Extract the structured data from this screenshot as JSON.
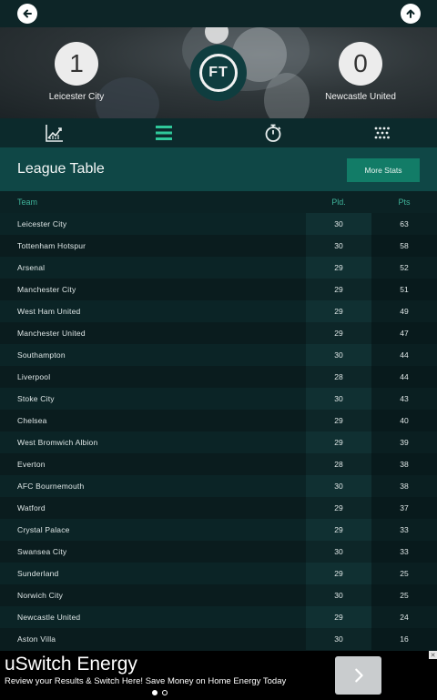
{
  "match": {
    "home": {
      "name": "Leicester City",
      "score": "1"
    },
    "away": {
      "name": "Newcastle United",
      "score": "0"
    },
    "status": "FT"
  },
  "tabs": [
    {
      "icon": "chart-icon",
      "active": false
    },
    {
      "icon": "list-icon",
      "active": true
    },
    {
      "icon": "stopwatch-icon",
      "active": false
    },
    {
      "icon": "grid-dots-icon",
      "active": false
    }
  ],
  "section": {
    "title": "League Table",
    "more_label": "More Stats"
  },
  "table": {
    "headers": {
      "team": "Team",
      "pld": "Pld.",
      "pts": "Pts"
    },
    "rows": [
      {
        "team": "Leicester City",
        "pld": "30",
        "pts": "63"
      },
      {
        "team": "Tottenham Hotspur",
        "pld": "30",
        "pts": "58"
      },
      {
        "team": "Arsenal",
        "pld": "29",
        "pts": "52"
      },
      {
        "team": "Manchester City",
        "pld": "29",
        "pts": "51"
      },
      {
        "team": "West Ham United",
        "pld": "29",
        "pts": "49"
      },
      {
        "team": "Manchester United",
        "pld": "29",
        "pts": "47"
      },
      {
        "team": "Southampton",
        "pld": "30",
        "pts": "44"
      },
      {
        "team": "Liverpool",
        "pld": "28",
        "pts": "44"
      },
      {
        "team": "Stoke City",
        "pld": "30",
        "pts": "43"
      },
      {
        "team": "Chelsea",
        "pld": "29",
        "pts": "40"
      },
      {
        "team": "West Bromwich Albion",
        "pld": "29",
        "pts": "39"
      },
      {
        "team": "Everton",
        "pld": "28",
        "pts": "38"
      },
      {
        "team": "AFC Bournemouth",
        "pld": "30",
        "pts": "38"
      },
      {
        "team": "Watford",
        "pld": "29",
        "pts": "37"
      },
      {
        "team": "Crystal Palace",
        "pld": "29",
        "pts": "33"
      },
      {
        "team": "Swansea City",
        "pld": "30",
        "pts": "33"
      },
      {
        "team": "Sunderland",
        "pld": "29",
        "pts": "25"
      },
      {
        "team": "Norwich City",
        "pld": "30",
        "pts": "25"
      },
      {
        "team": "Newcastle United",
        "pld": "29",
        "pts": "24"
      },
      {
        "team": "Aston Villa",
        "pld": "30",
        "pts": "16"
      }
    ]
  },
  "ad": {
    "title": "uSwitch Energy",
    "subtitle": "Review your Results & Switch Here! Save Money on Home Energy Today",
    "close": "✕",
    "page_indicator": {
      "pages": 2,
      "current": 1
    }
  },
  "colors": {
    "accent": "#127c67",
    "header_teal": "#0f4746",
    "row_odd": "#0b2426",
    "row_even": "#0a1c1e"
  }
}
